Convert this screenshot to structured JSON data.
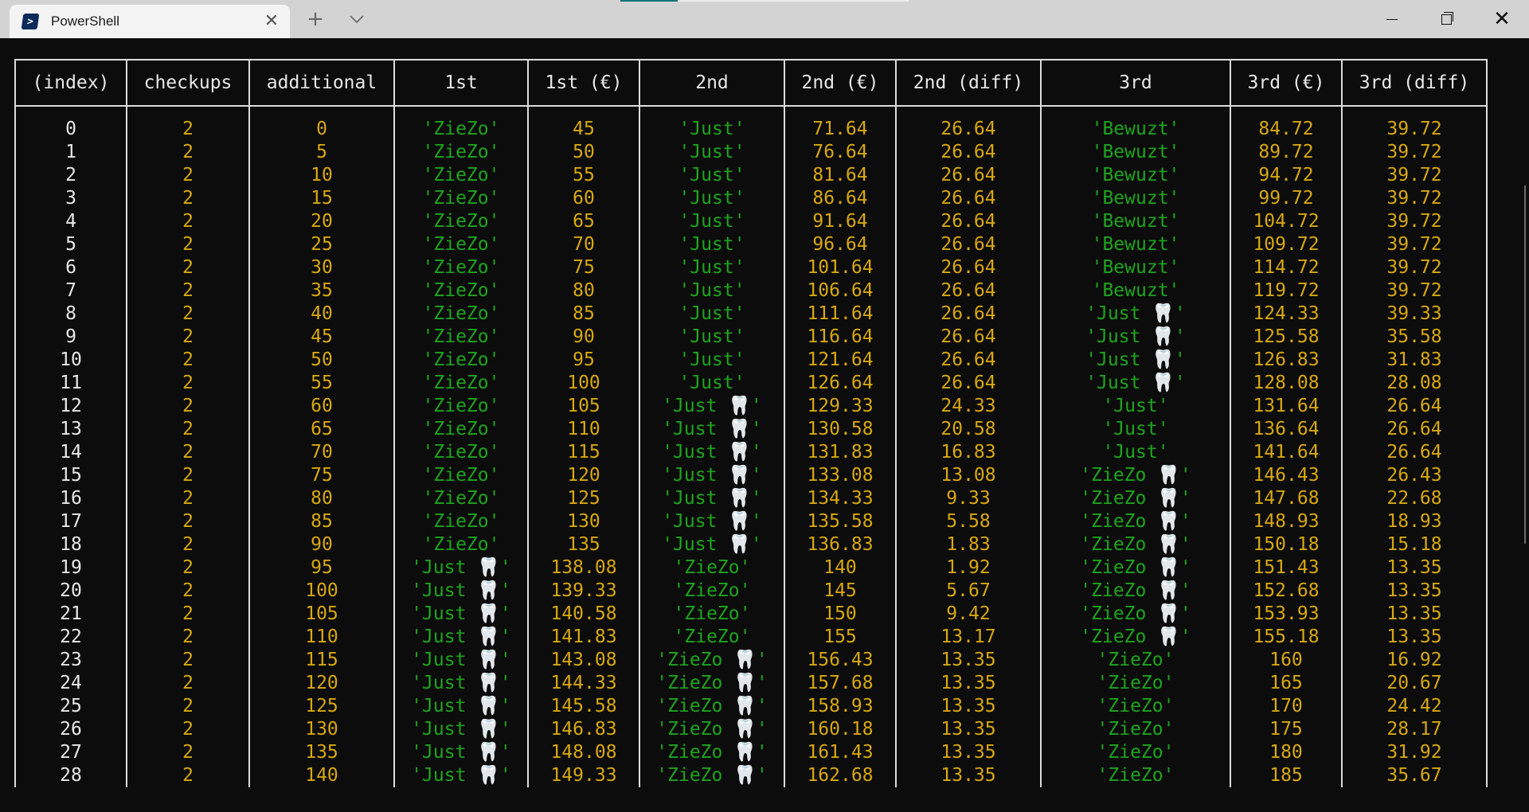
{
  "window": {
    "tab_title": "PowerShell",
    "tab_icon": "powershell-icon",
    "new_tab_label": "+",
    "dropdown_label": "⌄",
    "close_tab_label": "✕",
    "close_window_label": "✕"
  },
  "table": {
    "columns": [
      "(index)",
      "checkups",
      "additional",
      "1st",
      "1st (€)",
      "2nd",
      "2nd (€)",
      "2nd (diff)",
      "3rd",
      "3rd (€)",
      "3rd (diff)"
    ],
    "string_columns": [
      3,
      5,
      8
    ],
    "rows": [
      [
        "0",
        "2",
        "0",
        "'ZieZo'",
        "45",
        "'Just'",
        "71.64",
        "26.64",
        "'Bewuzt'",
        "84.72",
        "39.72"
      ],
      [
        "1",
        "2",
        "5",
        "'ZieZo'",
        "50",
        "'Just'",
        "76.64",
        "26.64",
        "'Bewuzt'",
        "89.72",
        "39.72"
      ],
      [
        "2",
        "2",
        "10",
        "'ZieZo'",
        "55",
        "'Just'",
        "81.64",
        "26.64",
        "'Bewuzt'",
        "94.72",
        "39.72"
      ],
      [
        "3",
        "2",
        "15",
        "'ZieZo'",
        "60",
        "'Just'",
        "86.64",
        "26.64",
        "'Bewuzt'",
        "99.72",
        "39.72"
      ],
      [
        "4",
        "2",
        "20",
        "'ZieZo'",
        "65",
        "'Just'",
        "91.64",
        "26.64",
        "'Bewuzt'",
        "104.72",
        "39.72"
      ],
      [
        "5",
        "2",
        "25",
        "'ZieZo'",
        "70",
        "'Just'",
        "96.64",
        "26.64",
        "'Bewuzt'",
        "109.72",
        "39.72"
      ],
      [
        "6",
        "2",
        "30",
        "'ZieZo'",
        "75",
        "'Just'",
        "101.64",
        "26.64",
        "'Bewuzt'",
        "114.72",
        "39.72"
      ],
      [
        "7",
        "2",
        "35",
        "'ZieZo'",
        "80",
        "'Just'",
        "106.64",
        "26.64",
        "'Bewuzt'",
        "119.72",
        "39.72"
      ],
      [
        "8",
        "2",
        "40",
        "'ZieZo'",
        "85",
        "'Just'",
        "111.64",
        "26.64",
        "'Just 🦷'",
        "124.33",
        "39.33"
      ],
      [
        "9",
        "2",
        "45",
        "'ZieZo'",
        "90",
        "'Just'",
        "116.64",
        "26.64",
        "'Just 🦷'",
        "125.58",
        "35.58"
      ],
      [
        "10",
        "2",
        "50",
        "'ZieZo'",
        "95",
        "'Just'",
        "121.64",
        "26.64",
        "'Just 🦷'",
        "126.83",
        "31.83"
      ],
      [
        "11",
        "2",
        "55",
        "'ZieZo'",
        "100",
        "'Just'",
        "126.64",
        "26.64",
        "'Just 🦷'",
        "128.08",
        "28.08"
      ],
      [
        "12",
        "2",
        "60",
        "'ZieZo'",
        "105",
        "'Just 🦷'",
        "129.33",
        "24.33",
        "'Just'",
        "131.64",
        "26.64"
      ],
      [
        "13",
        "2",
        "65",
        "'ZieZo'",
        "110",
        "'Just 🦷'",
        "130.58",
        "20.58",
        "'Just'",
        "136.64",
        "26.64"
      ],
      [
        "14",
        "2",
        "70",
        "'ZieZo'",
        "115",
        "'Just 🦷'",
        "131.83",
        "16.83",
        "'Just'",
        "141.64",
        "26.64"
      ],
      [
        "15",
        "2",
        "75",
        "'ZieZo'",
        "120",
        "'Just 🦷'",
        "133.08",
        "13.08",
        "'ZieZo 🦷'",
        "146.43",
        "26.43"
      ],
      [
        "16",
        "2",
        "80",
        "'ZieZo'",
        "125",
        "'Just 🦷'",
        "134.33",
        "9.33",
        "'ZieZo 🦷'",
        "147.68",
        "22.68"
      ],
      [
        "17",
        "2",
        "85",
        "'ZieZo'",
        "130",
        "'Just 🦷'",
        "135.58",
        "5.58",
        "'ZieZo 🦷'",
        "148.93",
        "18.93"
      ],
      [
        "18",
        "2",
        "90",
        "'ZieZo'",
        "135",
        "'Just 🦷'",
        "136.83",
        "1.83",
        "'ZieZo 🦷'",
        "150.18",
        "15.18"
      ],
      [
        "19",
        "2",
        "95",
        "'Just 🦷'",
        "138.08",
        "'ZieZo'",
        "140",
        "1.92",
        "'ZieZo 🦷'",
        "151.43",
        "13.35"
      ],
      [
        "20",
        "2",
        "100",
        "'Just 🦷'",
        "139.33",
        "'ZieZo'",
        "145",
        "5.67",
        "'ZieZo 🦷'",
        "152.68",
        "13.35"
      ],
      [
        "21",
        "2",
        "105",
        "'Just 🦷'",
        "140.58",
        "'ZieZo'",
        "150",
        "9.42",
        "'ZieZo 🦷'",
        "153.93",
        "13.35"
      ],
      [
        "22",
        "2",
        "110",
        "'Just 🦷'",
        "141.83",
        "'ZieZo'",
        "155",
        "13.17",
        "'ZieZo 🦷'",
        "155.18",
        "13.35"
      ],
      [
        "23",
        "2",
        "115",
        "'Just 🦷'",
        "143.08",
        "'ZieZo 🦷'",
        "156.43",
        "13.35",
        "'ZieZo'",
        "160",
        "16.92"
      ],
      [
        "24",
        "2",
        "120",
        "'Just 🦷'",
        "144.33",
        "'ZieZo 🦷'",
        "157.68",
        "13.35",
        "'ZieZo'",
        "165",
        "20.67"
      ],
      [
        "25",
        "2",
        "125",
        "'Just 🦷'",
        "145.58",
        "'ZieZo 🦷'",
        "158.93",
        "13.35",
        "'ZieZo'",
        "170",
        "24.42"
      ],
      [
        "26",
        "2",
        "130",
        "'Just 🦷'",
        "146.83",
        "'ZieZo 🦷'",
        "160.18",
        "13.35",
        "'ZieZo'",
        "175",
        "28.17"
      ],
      [
        "27",
        "2",
        "135",
        "'Just 🦷'",
        "148.08",
        "'ZieZo 🦷'",
        "161.43",
        "13.35",
        "'ZieZo'",
        "180",
        "31.92"
      ],
      [
        "28",
        "2",
        "140",
        "'Just 🦷'",
        "149.33",
        "'ZieZo 🦷'",
        "162.68",
        "13.35",
        "'ZieZo'",
        "185",
        "35.67"
      ]
    ]
  },
  "colors": {
    "background": "#0c0c0c",
    "number": "#d7a80f",
    "string": "#1ea51e",
    "index": "#e8e8e8",
    "border": "#dcdcdc",
    "tab_accent": "#11777a"
  }
}
